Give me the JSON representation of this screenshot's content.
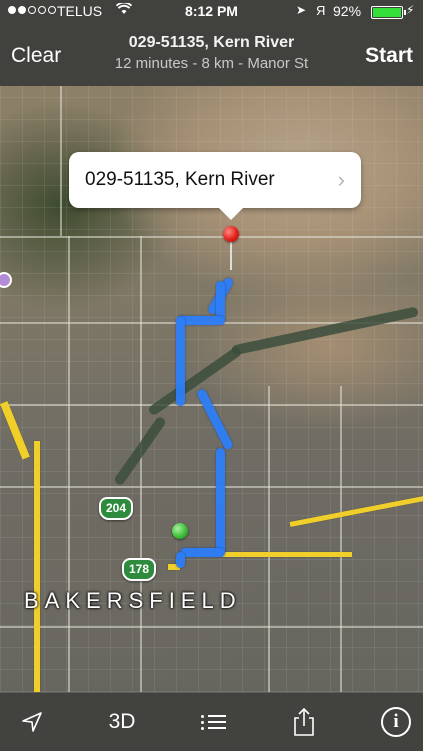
{
  "status_bar": {
    "carrier": "TELUS",
    "time": "8:12 PM",
    "battery": "92%",
    "battery_level": 0.92
  },
  "nav": {
    "left_button": "Clear",
    "title": "029-51135, Kern River",
    "subtitle": "12 minutes - 8 km - Manor St",
    "right_button": "Start"
  },
  "map": {
    "callout_title": "029-51135, Kern River",
    "city_label": "BAKERSFIELD",
    "shields": [
      "204",
      "178"
    ],
    "route_color": "#2d7ef7",
    "highway_color": "#f1cf2a"
  },
  "toolbar": {
    "three_d_label": "3D",
    "icons": [
      "location-arrow-icon",
      "list-icon",
      "share-icon",
      "info-icon"
    ]
  }
}
